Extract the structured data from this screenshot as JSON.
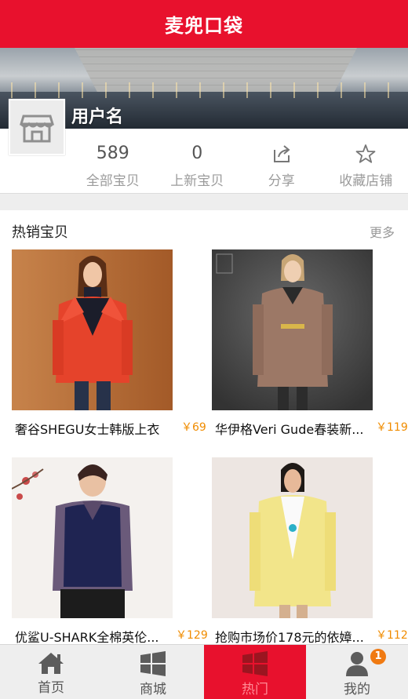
{
  "header": {
    "title": "麦兜口袋"
  },
  "store": {
    "username": "用户名",
    "avatar_icon": "store-icon"
  },
  "stats": [
    {
      "value": "589",
      "label": "全部宝贝"
    },
    {
      "value": "0",
      "label": "上新宝贝"
    },
    {
      "icon": "share-icon",
      "label": "分享"
    },
    {
      "icon": "star-icon",
      "label": "收藏店铺"
    }
  ],
  "section": {
    "title": "热销宝贝",
    "more": "更多"
  },
  "products": [
    {
      "name": "奢谷SHEGU女士韩版上衣",
      "price": "￥69",
      "image": "red-coat-photo"
    },
    {
      "name": "华伊格Veri Gude春装新...",
      "price": "￥119",
      "image": "camel-coat-photo"
    },
    {
      "name": "优鲨U-SHARK全棉英伦...",
      "price": "￥129",
      "image": "floral-blouse-vest-photo"
    },
    {
      "name": "抢购市场价178元的依嫜...",
      "price": "￥112",
      "image": "yellow-coat-photo"
    }
  ],
  "bottom_nav": [
    {
      "label": "首页",
      "icon": "home-icon",
      "active": false
    },
    {
      "label": "商城",
      "icon": "windows-grid-icon",
      "active": false
    },
    {
      "label": "热门",
      "icon": "windows-grid-icon",
      "active": true
    },
    {
      "label": "我的",
      "icon": "user-icon",
      "active": false,
      "badge": "1"
    }
  ],
  "colors": {
    "brand_red": "#e8112d",
    "price_orange": "#f08c00",
    "badge_orange": "#f07a12"
  }
}
